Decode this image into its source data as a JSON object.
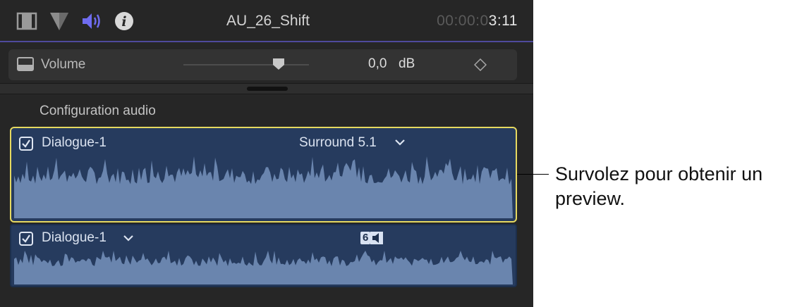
{
  "header": {
    "clip_name": "AU_26_Shift",
    "timecode_dim": "00:00:0",
    "timecode_bright": "3:11",
    "icons": [
      "video-inspector-icon",
      "color-inspector-icon",
      "audio-inspector-icon",
      "info-inspector-icon"
    ],
    "active_color": "#6f6cf0"
  },
  "volume": {
    "label": "Volume",
    "value": "0,0",
    "unit": "dB",
    "level_fraction": 0.76
  },
  "audio_config": {
    "title": "Configuration audio",
    "tracks": [
      {
        "name": "Dialogue-1",
        "checked": true,
        "configuration": "Surround 5.1",
        "selected": true
      },
      {
        "name": "Dialogue-1",
        "checked": true,
        "channel_count": "6",
        "selected": false
      }
    ]
  },
  "callout": {
    "text": "Survolez pour obtenir un preview."
  },
  "colors": {
    "panel_bg": "#262626",
    "track_bg": "#263b5e",
    "wave_fill": "#6a85ae",
    "selection_border": "#e6d960"
  }
}
